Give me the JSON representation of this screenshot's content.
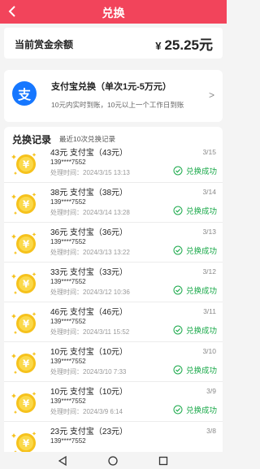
{
  "header": {
    "title": "兑换"
  },
  "balance": {
    "label": "当前赏金余额",
    "currency": "¥",
    "amount": "25.25元"
  },
  "alipay": {
    "title": "支付宝兑换（单次1元-5万元）",
    "desc": "10元内实时到账，10元以上一个工作日到账",
    "logo_char": "支"
  },
  "records": {
    "title": "兑换记录",
    "subtitle": "最近10次兑换记录",
    "items": [
      {
        "title": "43元 支付宝（43元）",
        "phone": "139****7552",
        "time": "处理时间：2024/3/15 13:13",
        "date": "3/15",
        "status": "兑换成功"
      },
      {
        "title": "38元 支付宝（38元）",
        "phone": "139****7552",
        "time": "处理时间：2024/3/14 13:28",
        "date": "3/14",
        "status": "兑换成功"
      },
      {
        "title": "36元 支付宝（36元）",
        "phone": "139****7552",
        "time": "处理时间：2024/3/13 13:22",
        "date": "3/13",
        "status": "兑换成功"
      },
      {
        "title": "33元 支付宝（33元）",
        "phone": "139****7552",
        "time": "处理时间：2024/3/12 10:36",
        "date": "3/12",
        "status": "兑换成功"
      },
      {
        "title": "46元 支付宝（46元）",
        "phone": "139****7552",
        "time": "处理时间：2024/3/11 15:52",
        "date": "3/11",
        "status": "兑换成功"
      },
      {
        "title": "10元 支付宝（10元）",
        "phone": "139****7552",
        "time": "处理时间：2024/3/10 7:33",
        "date": "3/10",
        "status": "兑换成功"
      },
      {
        "title": "10元 支付宝（10元）",
        "phone": "139****7552",
        "time": "处理时间：2024/3/9 6:14",
        "date": "3/9",
        "status": "兑换成功"
      },
      {
        "title": "23元 支付宝（23元）",
        "phone": "139****7552",
        "time": "",
        "date": "3/8",
        "status": ""
      }
    ]
  },
  "icons": {
    "back": "chevron-left-icon",
    "coin": "gold-coin-icon",
    "ok": "check-circle-icon",
    "chevron": "chevron-right-icon"
  },
  "colors": {
    "header": "#f2445b",
    "success": "#1aa94a",
    "alipay": "#1677ff",
    "coin": "#f6c21c"
  }
}
